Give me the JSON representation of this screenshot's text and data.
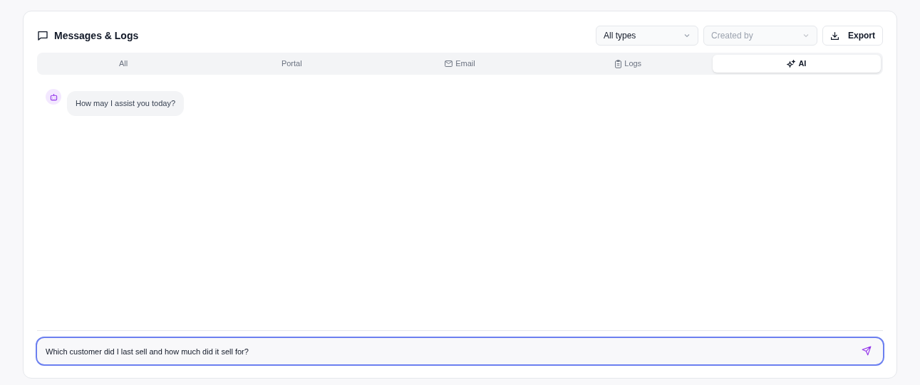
{
  "panel": {
    "title": "Messages & Logs"
  },
  "filters": [
    {
      "value": "All types",
      "is_placeholder": false
    },
    {
      "value": "Created by",
      "is_placeholder": true
    }
  ],
  "export_button": "Export",
  "tabs": [
    {
      "label": "All",
      "selected": false
    },
    {
      "label": "Portal",
      "selected": false
    },
    {
      "label": "Email",
      "selected": false
    },
    {
      "label": "Logs",
      "selected": false
    },
    {
      "label": "AI",
      "selected": true
    }
  ],
  "messages": [
    {
      "text": "How may I assist you today?"
    }
  ],
  "composer": {
    "value": "Which customer did I last sell and how much did it sell for?",
    "focused": true
  }
}
